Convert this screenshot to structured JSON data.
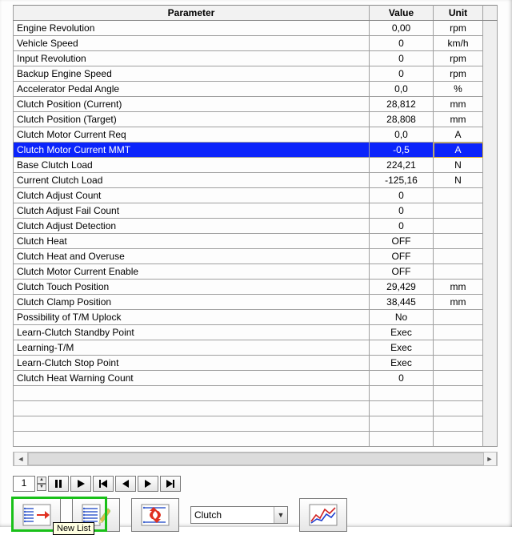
{
  "columns": {
    "param": "Parameter",
    "value": "Value",
    "unit": "Unit"
  },
  "selected_index": 7,
  "rows": [
    {
      "param": "Engine Revolution",
      "value": "0,00",
      "unit": "rpm"
    },
    {
      "param": "Vehicle Speed",
      "value": "0",
      "unit": "km/h"
    },
    {
      "param": "Input Revolution",
      "value": "0",
      "unit": "rpm"
    },
    {
      "param": "Backup Engine Speed",
      "value": "0",
      "unit": "rpm"
    },
    {
      "param": "Accelerator Pedal Angle",
      "value": "0,0",
      "unit": "%"
    },
    {
      "param": "Clutch Position (Current)",
      "value": "28,812",
      "unit": "mm"
    },
    {
      "param": "Clutch Position (Target)",
      "value": "28,808",
      "unit": "mm"
    },
    {
      "param": "Clutch Motor Current Req",
      "value": "0,0",
      "unit": "A"
    },
    {
      "param": "Clutch Motor Current MMT",
      "value": "-0,5",
      "unit": "A"
    },
    {
      "param": "Base Clutch Load",
      "value": "224,21",
      "unit": "N"
    },
    {
      "param": "Current Clutch Load",
      "value": "-125,16",
      "unit": "N"
    },
    {
      "param": "Clutch Adjust Count",
      "value": "0",
      "unit": ""
    },
    {
      "param": "Clutch Adjust Fail Count",
      "value": "0",
      "unit": ""
    },
    {
      "param": "Clutch Adjust Detection",
      "value": "0",
      "unit": ""
    },
    {
      "param": "Clutch Heat",
      "value": "OFF",
      "unit": ""
    },
    {
      "param": "Clutch Heat and Overuse",
      "value": "OFF",
      "unit": ""
    },
    {
      "param": "Clutch Motor Current Enable",
      "value": "OFF",
      "unit": ""
    },
    {
      "param": "Clutch Touch Position",
      "value": "29,429",
      "unit": "mm"
    },
    {
      "param": "Clutch Clamp Position",
      "value": "38,445",
      "unit": "mm"
    },
    {
      "param": "Possibility of T/M Uplock",
      "value": "No",
      "unit": ""
    },
    {
      "param": "Learn-Clutch Standby Point",
      "value": "Exec",
      "unit": ""
    },
    {
      "param": "Learning-T/M",
      "value": "Exec",
      "unit": ""
    },
    {
      "param": "Learn-Clutch Stop Point",
      "value": "Exec",
      "unit": ""
    },
    {
      "param": "Clutch Heat Warning Count",
      "value": "0",
      "unit": ""
    }
  ],
  "blank_rows": 4,
  "playback": {
    "frame": "1"
  },
  "dropdown": {
    "selected": "Clutch"
  },
  "tooltip": {
    "text": "New List"
  }
}
